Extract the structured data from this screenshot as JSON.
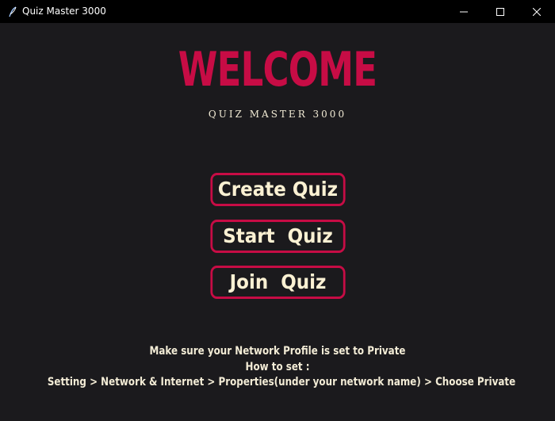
{
  "window": {
    "title": "Quiz Master 3000",
    "icon": "feather-icon"
  },
  "header": {
    "welcome": "WELCOME",
    "subtitle": "QUIZ MASTER 3000"
  },
  "menu": {
    "create_label": "Create Quiz",
    "start_label": "Start  Quiz",
    "join_label": "Join  Quiz"
  },
  "notice": {
    "line1": "Make sure your Network Profile is set to Private",
    "line2": "How to set :",
    "line3": "Setting > Network & Internet > Properties(under your network name) > Choose Private"
  },
  "colors": {
    "accent": "#c70c45",
    "background": "#1b1a1d",
    "text": "#f3ecd6",
    "titlebar": "#000000"
  }
}
